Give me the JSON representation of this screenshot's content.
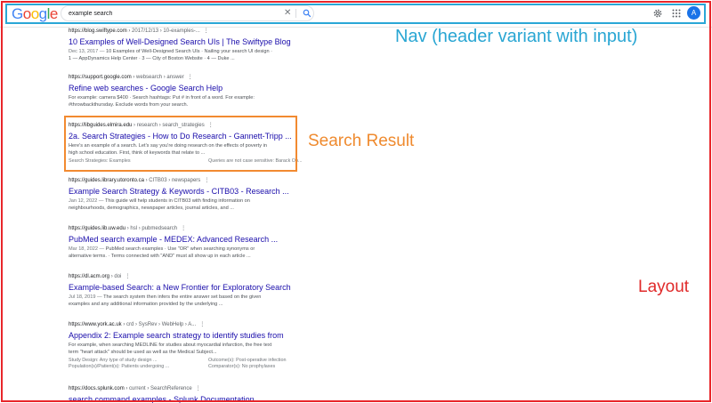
{
  "header": {
    "logo": "Google",
    "search": {
      "value": "example search",
      "placeholder": ""
    },
    "avatar_initial": "A"
  },
  "annotations": {
    "nav": "Nav (header variant with input)",
    "search_result": "Search Result",
    "layout": "Layout"
  },
  "results": [
    {
      "url": "https://blog.swiftype.com",
      "path": " › 2017/12/13 › 10-examples-...",
      "title": "10 Examples of Well-Designed Search UIs | The Swiftype Blog",
      "date": "Dec 13, 2017 — ",
      "lines": [
        "10 Examples of Well-Designed Search UIs · Nailing your search UI design · ",
        "1 — AppDynamics Help Center · 3 — City of Boston Website · 4 — Duke ..."
      ]
    },
    {
      "url": "https://support.google.com",
      "path": " › websearch › answer",
      "title": "Refine web searches - Google Search Help",
      "date": "",
      "lines": [
        "For example: camera $400 · Search hashtags: Put # in front of a word. For example:",
        "#throwbackthursday. Exclude words from your search."
      ]
    },
    {
      "url": "https://libguides.elmira.edu",
      "path": " › research › search_strategies",
      "title": "2a. Search Strategies - How to Do Research - Gannett-Tripp ...",
      "date": "",
      "lines": [
        "Here's an example of a search. Let's say you're doing research on the effects of poverty in",
        "high school education. First, think of keywords that relate to ..."
      ],
      "facts": [
        [
          "Search Strategies: Examples",
          "Queries are not case sensitive: Barack Ob..."
        ]
      ]
    },
    {
      "url": "https://guides.library.utoronto.ca",
      "path": " › CITB03 › newspapers",
      "title": "Example Search Strategy & Keywords - CITB03 - Research ...",
      "date": "Jan 12, 2022 — ",
      "lines": [
        "This guide will help students in CITB03 with finding information on",
        "neighbourhoods, demographics, newspaper articles, journal articles, and ..."
      ]
    },
    {
      "url": "https://guides.lib.uw.edu",
      "path": " › hsl › pubmedsearch",
      "title": "PubMed search example - MEDEX: Advanced Research ...",
      "date": "Mar 18, 2022 — ",
      "lines": [
        "PubMed search examples · Use \"OR\" when searching synonyms or",
        "alternative terms. · Terms connected with \"AND\" must all show up in each article ..."
      ]
    },
    {
      "url": "https://dl.acm.org",
      "path": " › doi",
      "title": "Example-based Search: a New Frontier for Exploratory Search",
      "date": "Jul 18, 2019 — ",
      "lines": [
        "The search system then infers the entire answer set based on the given",
        "examples and any additional information provided by the underlying ..."
      ]
    },
    {
      "url": "https://www.york.ac.uk",
      "path": " › crd › SysRev › WebHelp › A...",
      "title": "Appendix 2: Example search strategy to identify studies from",
      "date": "",
      "lines": [
        "For example, when searching MEDLINE for studies about myocardial infarction, the free text",
        "term \"heart attack\" should be used as well as the Medical Subject..."
      ],
      "facts": [
        [
          "Study Design: Any type of study design ...",
          "Outcome(s): Post-operative infection"
        ],
        [
          "Population(s)/Patient(s): Patients undergoing ...",
          "Comparator(s): No prophylaxes"
        ]
      ]
    },
    {
      "url": "https://docs.splunk.com",
      "path": " › current › SearchReference",
      "title": "search command examples - Splunk Documentation",
      "date": "",
      "lines": []
    }
  ]
}
